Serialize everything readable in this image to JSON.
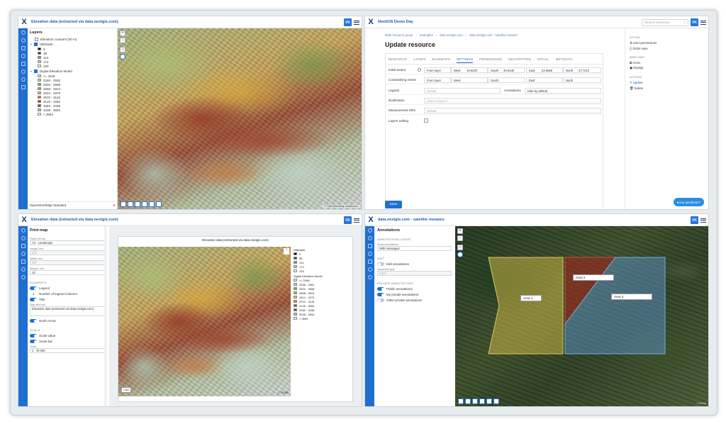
{
  "w1": {
    "title": "Elevation data (extracted via data.nextgis.com)",
    "avatar": "VK",
    "panel_title": "Layers",
    "layers": [
      {
        "label": "Elevation contours (50 m)"
      },
      {
        "label": "Hillshade"
      },
      {
        "label": "Digital Elevation Model"
      }
    ],
    "hillshade_legend": [
      "0",
      "38",
      "113",
      "172",
      "230"
    ],
    "hillshade_colors": [
      "#000000",
      "#3a3a3a",
      "#8a8a8a",
      "#c0c0c0",
      "#efefef"
    ],
    "dem_legend": [
      "<= 2346",
      "2346 - 2502",
      "2502 - 2658",
      "2658 - 2814",
      "2814 - 2970",
      "2970 - 3126",
      "3126 - 3282",
      "3282 - 3438",
      "3438 - 3594",
      "> 3594"
    ],
    "dem_colors": [
      "#cfe8cf",
      "#a9d59a",
      "#6fae5f",
      "#9bb04a",
      "#e0b53c",
      "#d07a3a",
      "#a5432e",
      "#8a3a2c",
      "#b9b2ae",
      "#f2f2f2"
    ],
    "basemap": "OpenStreetMap Standard",
    "attribution": "© OpenStreetMap contributors"
  },
  "w2": {
    "title": "NextGIS Demo Day",
    "avatar": "VK",
    "search_placeholder": "Search resources",
    "breadcrumbs": [
      "Main resource group",
      "Examples",
      "data.nextgis.com",
      "data.nextgis.com - satellite mosaics"
    ],
    "page_title": "Update resource",
    "tabs": [
      "RESOURCE",
      "LAYERS",
      "BASEMAPS",
      "SETTINGS",
      "PERMISSIONS",
      "DESCRIPTION",
      "SOCIAL",
      "METADATA"
    ],
    "rows": {
      "initial_extent": {
        "label": "Initial extent",
        "from_layer": "From layer",
        "west_label": "West",
        "west": "16.8200",
        "south_label": "South",
        "south": "45.6140",
        "east_label": "East",
        "east": "22.5660",
        "north_label": "North",
        "north": "47.7210"
      },
      "constraining_extent": {
        "label": "Constraining extent",
        "from_layer": "From layer",
        "west_label": "West",
        "south_label": "South",
        "east_label": "East",
        "north_label": "North"
      },
      "legend": {
        "label": "Legend",
        "value": "Default",
        "annotations_label": "Annotations",
        "annotations_value": "Hide by default"
      },
      "bookmarks": {
        "label": "Bookmarks",
        "value": "Select resource"
      },
      "measurement": {
        "label": "Measurement SRS",
        "value": "Default"
      },
      "layers_editing": {
        "label": "Layers editing"
      }
    },
    "save": "Save",
    "side": {
      "extra_title": "EXTRA",
      "extra": [
        "User permissions",
        "JSON view"
      ],
      "webmap_title": "WEB MAP",
      "webmap": [
        "Clone",
        "Display"
      ],
      "action_title": "ACTION",
      "action": [
        "Update",
        "Delete"
      ]
    },
    "help": "Any questions?"
  },
  "w3": {
    "title": "Elevation data (extracted via data.nextgis.com)",
    "avatar": "VK",
    "panel_title": "Print map",
    "paper_format_label": "Paper format",
    "paper_format": "A4 - Landscape",
    "height_label": "Height, mm",
    "height": "210",
    "width_label": "Width, mm",
    "width": "297",
    "margin_label": "Margin, mm",
    "margin": "10",
    "elements_title": "ELEMENTS",
    "legend_label": "Legend",
    "legend_cols_label": "Number of legend columns",
    "legend_cols": "1",
    "title_label": "Title",
    "map_title_label": "Map title text",
    "map_title": "Elevation data (extracted via data.nextgis.com)",
    "north_arrow": "North Arrow",
    "scale_title": "SCALE",
    "scale_value": "Scale value",
    "scale_bar": "Scale bar",
    "scale_label": "Scale",
    "scale": "1 : 78 000",
    "preview_title": "Elevation data (extracted via data.nextgis.com)",
    "preview_hillshade": "Hillshade",
    "preview_dem": "Digital Elevation Model",
    "scalebar_text": "1 km",
    "scale_text": "1 : 78 000"
  },
  "w4": {
    "title": "data.nextgis.com - satellite mosaics",
    "avatar": "VK",
    "panel_title": "Annotations",
    "layer_title": "ANNOTATIONS LAYER",
    "show_label": "Show annotations",
    "show_value": "With messages",
    "edit_title": "EDIT",
    "edit_label": "Edit annotations",
    "geom_label": "Geometry type",
    "geom_value": "Point",
    "private_title": "PRIVATE ANNOTATIONS",
    "public": "Public annotations",
    "mine": "My private annotations",
    "others": "Other private annotations",
    "areas": [
      "Area 1",
      "Area 2",
      "Area 3"
    ],
    "attribution": "© Maxar"
  }
}
